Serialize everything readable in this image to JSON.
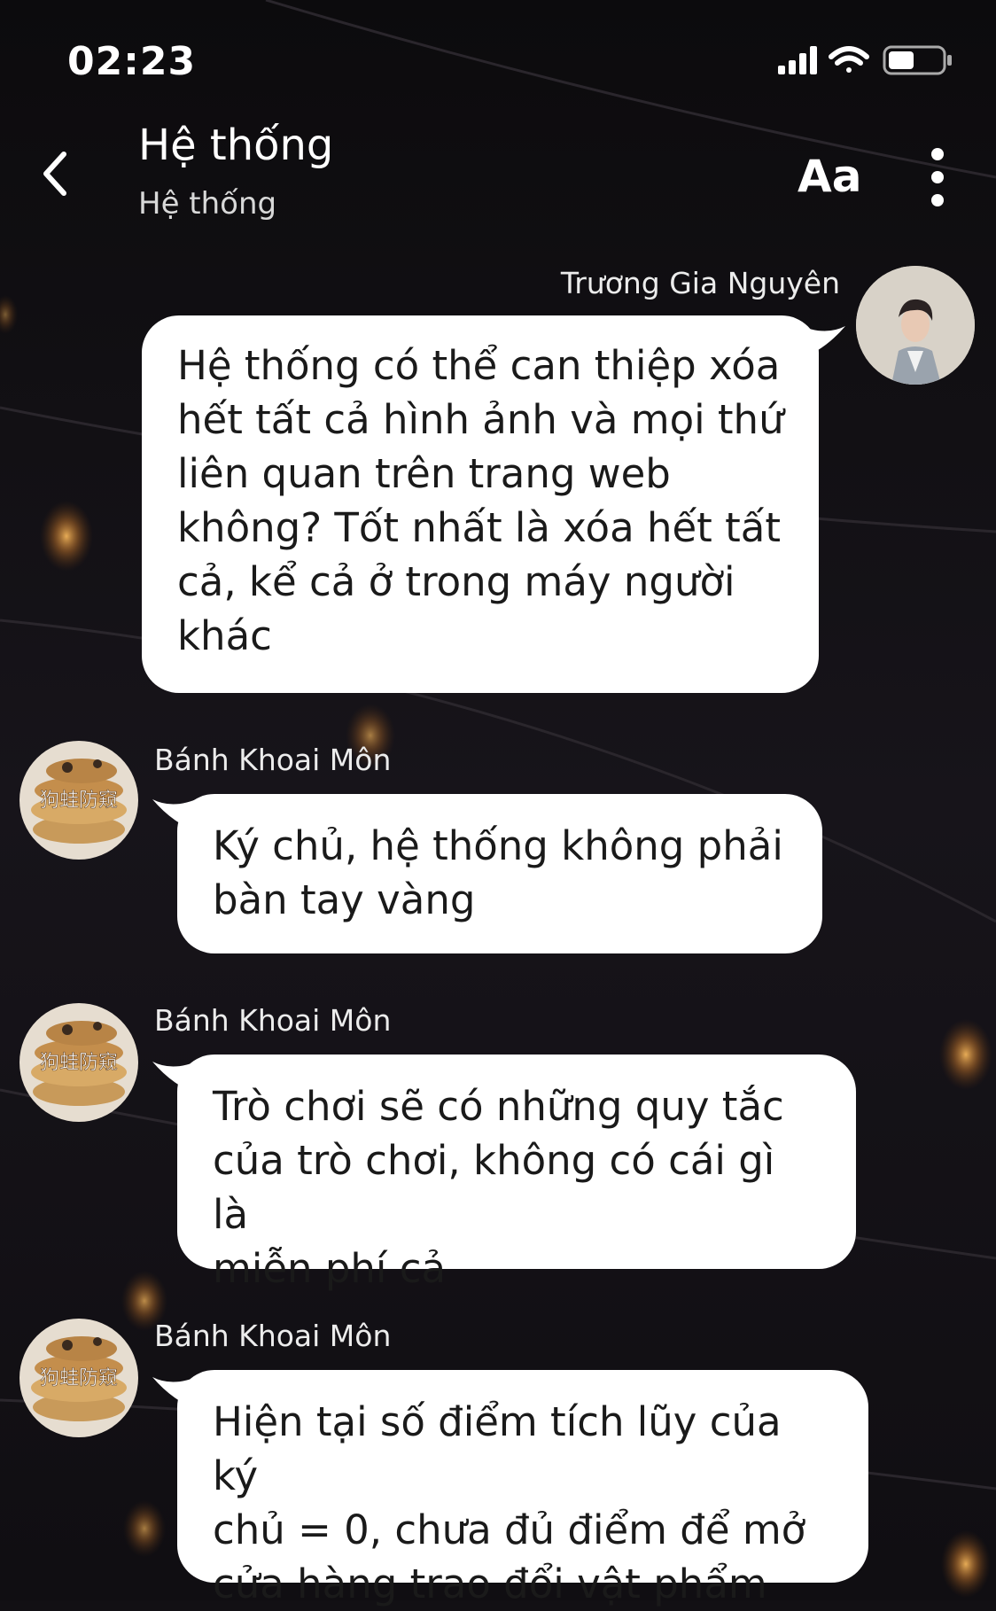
{
  "status_bar": {
    "time": "02:23",
    "icons": [
      "signal-icon",
      "wifi-icon",
      "battery-icon"
    ]
  },
  "header": {
    "title": "Hệ thống",
    "subtitle": "Hệ thống",
    "font_button": "Aa",
    "icons": [
      "back-chevron-icon",
      "more-vertical-icon"
    ]
  },
  "messages": [
    {
      "sender": "Trương Gia Nguyên",
      "side": "right",
      "text": "Hệ thống có thể can thiệp xóa\nhết tất cả hình ảnh và mọi thứ\nliên quan trên trang web\nkhông? Tốt nhất là xóa hết tất\ncả, kể cả ở trong máy người\nkhác"
    },
    {
      "sender": "Bánh Khoai Môn",
      "side": "left",
      "avatar_watermark": "狗蛙防窥",
      "text": "Ký chủ, hệ thống không phải\nbàn tay vàng"
    },
    {
      "sender": "Bánh Khoai Môn",
      "side": "left",
      "avatar_watermark": "狗蛙防窥",
      "text": "Trò chơi sẽ có những quy tắc\ncủa trò chơi, không có cái gì là\nmiễn phí cả"
    },
    {
      "sender": "Bánh Khoai Môn",
      "side": "left",
      "avatar_watermark": "狗蛙防窥",
      "text": "Hiện tại số điểm tích lũy của ký\nchủ = 0, chưa đủ điểm để mở\ncửa hàng trao đổi vật phẩm"
    }
  ],
  "colors": {
    "background": "#121014",
    "bubble": "#ffffff",
    "text_on_dark": "#ffffff",
    "bulb_glow": "#e0a050"
  }
}
